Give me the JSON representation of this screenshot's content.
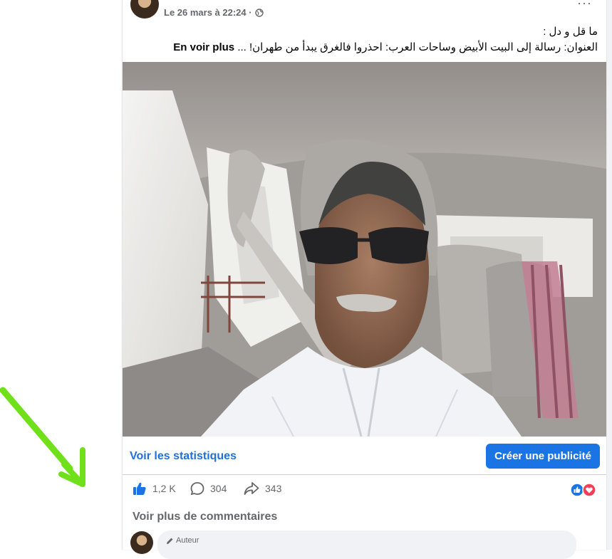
{
  "post": {
    "timestamp": "Le 26 mars à 22:24 ·",
    "more_dots": "···",
    "text_line1": "ما قل و دل :",
    "text_line2": "العنوان: رسالة إلى البيت الأبيض وساحات العرب: احذروا فالغرق يبدأ من طهران! ...",
    "see_more": "En voir plus"
  },
  "actions": {
    "stats_label": "Voir les statistiques",
    "ad_button": "Créer une publicité",
    "likes": "1,2 K",
    "comments": "304",
    "shares": "343"
  },
  "comments": {
    "more_label": "Voir plus de commentaires",
    "author_badge": "Auteur"
  },
  "colors": {
    "accent": "#1b74e4",
    "link": "#216fdb",
    "arrow": "#6fe01a",
    "love": "#f33e58"
  },
  "icons": [
    "globe-icon",
    "like-icon",
    "comment-icon",
    "share-icon",
    "like-reaction-icon",
    "love-reaction-icon",
    "pencil-icon",
    "arrow-annotation"
  ]
}
